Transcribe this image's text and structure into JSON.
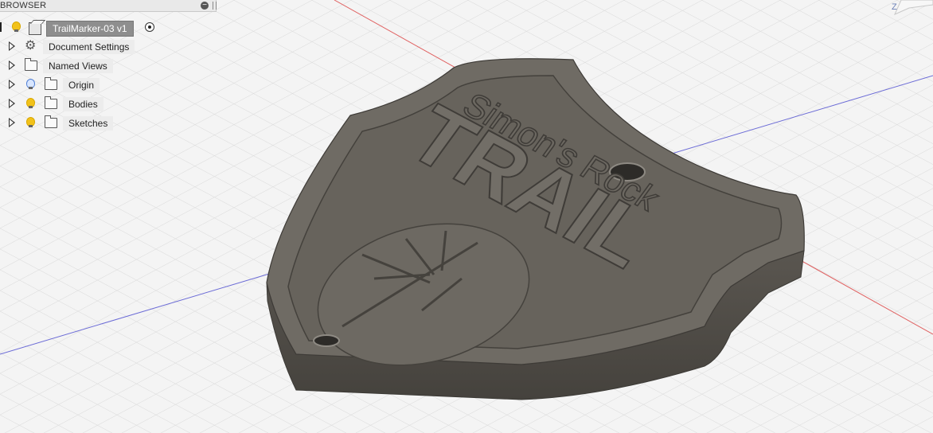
{
  "browser": {
    "title": "BROWSER",
    "collapse_symbol": "−",
    "root": {
      "label": "TrailMarker-03 v1"
    },
    "items": [
      {
        "label": "Document Settings",
        "icon": "gear-icon",
        "visibility": null
      },
      {
        "label": "Named Views",
        "icon": "folder-icon",
        "visibility": null
      },
      {
        "label": "Origin",
        "icon": "folder-icon",
        "visibility": "off"
      },
      {
        "label": "Bodies",
        "icon": "folder-icon",
        "visibility": "on"
      },
      {
        "label": "Sketches",
        "icon": "folder-icon",
        "visibility": "on"
      }
    ]
  },
  "viewcube": {
    "axis_label": "Z"
  },
  "model": {
    "title_top": "Simon's Rock",
    "title_main": "TRAIL",
    "colors": {
      "body": "#5f5b55",
      "top_face": "#77736c",
      "side": "#4c4944",
      "x_axis": "#e05050",
      "y_axis": "#5a5ad8",
      "grid": "#dcdcdc"
    }
  }
}
